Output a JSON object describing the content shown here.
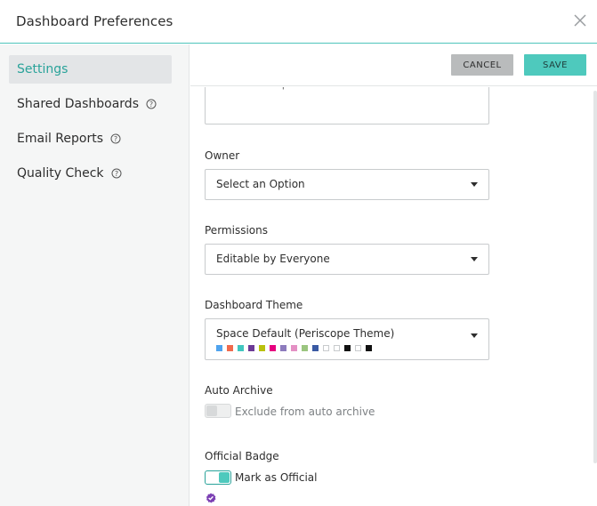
{
  "header": {
    "title": "Dashboard Preferences",
    "close_icon": "close-icon"
  },
  "sidebar": {
    "items": [
      {
        "label": "Settings",
        "active": true,
        "help": false
      },
      {
        "label": "Shared Dashboards",
        "active": false,
        "help": true
      },
      {
        "label": "Email Reports",
        "active": false,
        "help": true
      },
      {
        "label": "Quality Check",
        "active": false,
        "help": true
      }
    ],
    "help_icon": "question-circle-icon"
  },
  "toolbar": {
    "cancel_label": "CANCEL",
    "save_label": "SAVE"
  },
  "form": {
    "description": {
      "placeholder": "Enter Description",
      "value": ""
    },
    "owner": {
      "label": "Owner",
      "selected": "Select an Option"
    },
    "permissions": {
      "label": "Permissions",
      "selected": "Editable by Everyone"
    },
    "theme": {
      "label": "Dashboard Theme",
      "selected": "Space Default (Periscope Theme)",
      "swatches": [
        "#4fa3ee",
        "#f06a4d",
        "#41c6bf",
        "#6c3a96",
        "#b9c10e",
        "#e6007e",
        "#8d7bbd",
        "#e490c4",
        "#9bc57f",
        "#3a5aa3",
        "#ffffff",
        "#ffffff",
        "#111111",
        "#ffffff",
        "#111111"
      ]
    },
    "auto_archive": {
      "label": "Auto Archive",
      "toggle_label": "Exclude from auto archive",
      "enabled": false
    },
    "official_badge": {
      "label": "Official Badge",
      "toggle_label": "Mark as Official",
      "enabled": true,
      "badge_icon": "verified-badge-icon"
    }
  },
  "colors": {
    "accent": "#4ec9bd",
    "accent_dark": "#2aa39a",
    "badge": "#7b3fb3"
  }
}
